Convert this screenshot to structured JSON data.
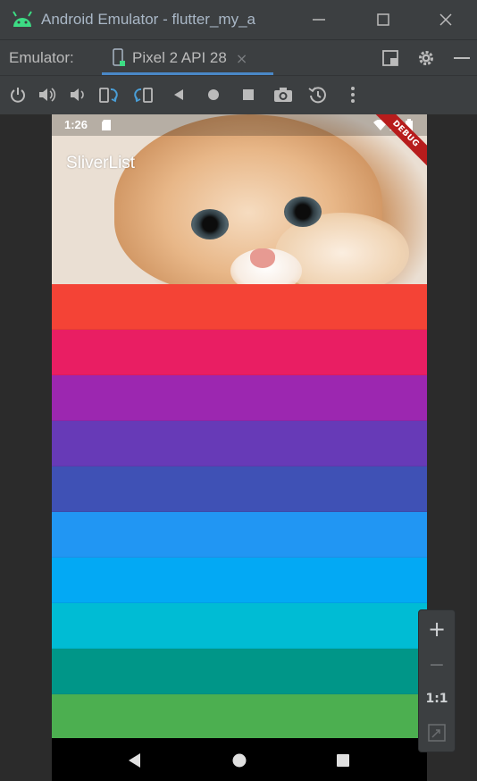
{
  "window": {
    "title": "Android Emulator - flutter_my_a",
    "colors": {
      "android_green": "#3ddc84",
      "frame": "#3c3f41"
    }
  },
  "tabbar": {
    "label": "Emulator:",
    "tab_name": "Pixel 2 API 28",
    "close_glyph": "×",
    "icons": [
      "restore-layout-icon",
      "gear-icon",
      "minimize-icon"
    ]
  },
  "toolbar": {
    "icons": [
      "power-icon",
      "volume-up-icon",
      "volume-down-icon",
      "rotate-left-icon",
      "rotate-right-icon",
      "back-icon",
      "home-icon",
      "overview-icon",
      "screenshot-icon",
      "snapshot-icon",
      "more-icon"
    ]
  },
  "device": {
    "status_time": "1:26",
    "debug_banner": "DEBUG",
    "app_title": "SliverList",
    "list_colors": [
      "#f44336",
      "#e91e63",
      "#9c27b0",
      "#673ab7",
      "#3f51b5",
      "#2196f3",
      "#03a9f4",
      "#00bcd4",
      "#009688",
      "#4caf50"
    ]
  },
  "zoom": {
    "zoom_in": "+",
    "zoom_out": "−",
    "actual_size": "1:1"
  }
}
